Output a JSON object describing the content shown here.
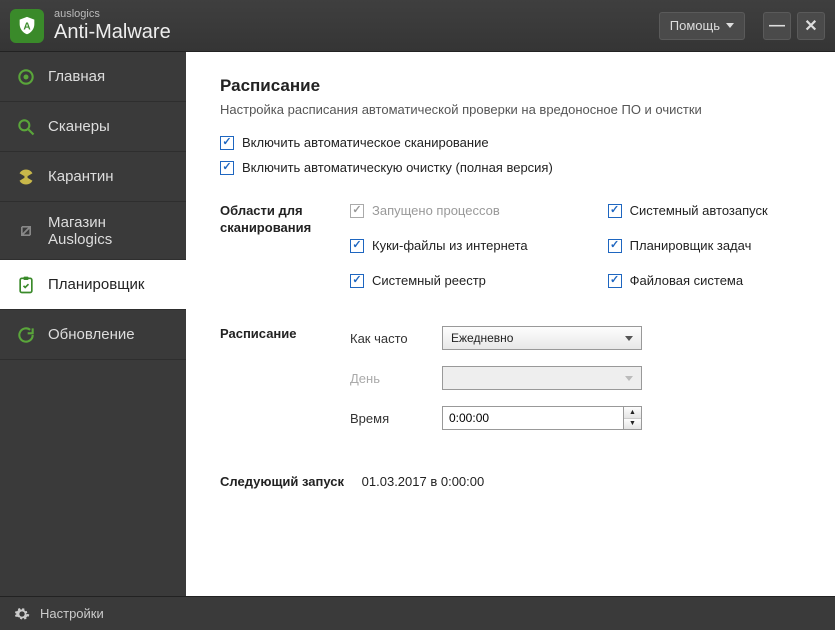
{
  "titlebar": {
    "brand_small": "auslogics",
    "brand_big": "Anti-Malware",
    "help_label": "Помощь"
  },
  "sidebar": {
    "items": [
      {
        "label": "Главная",
        "icon": "target-icon"
      },
      {
        "label": "Сканеры",
        "icon": "search-icon"
      },
      {
        "label": "Карантин",
        "icon": "radioactive-icon"
      },
      {
        "label": "Магазин Auslogics",
        "icon": "globe-icon"
      },
      {
        "label": "Планировщик",
        "icon": "clipboard-icon"
      },
      {
        "label": "Обновление",
        "icon": "refresh-icon"
      }
    ],
    "active_index": 4
  },
  "main": {
    "title": "Расписание",
    "subtitle": "Настройка расписания автоматической проверки на вредоносное ПО и очистки",
    "enable_scan": "Включить автоматическое сканирование",
    "enable_clean": "Включить автоматическую очистку (полная версия)",
    "scan_areas_label": "Области для сканирования",
    "scan_areas": {
      "left": [
        {
          "label": "Запущено процессов",
          "checked": true,
          "disabled": true
        },
        {
          "label": "Куки-файлы из интернета",
          "checked": true,
          "disabled": false
        },
        {
          "label": "Системный реестр",
          "checked": true,
          "disabled": false
        }
      ],
      "right": [
        {
          "label": "Системный автозапуск",
          "checked": true,
          "disabled": false
        },
        {
          "label": "Планировщик задач",
          "checked": true,
          "disabled": false
        },
        {
          "label": "Файловая система",
          "checked": true,
          "disabled": false
        }
      ]
    },
    "schedule_label": "Расписание",
    "how_often_label": "Как часто",
    "how_often_value": "Ежедневно",
    "day_label": "День",
    "day_value": "",
    "time_label": "Время",
    "time_value": "0:00:00",
    "next_run_label": "Следующий запуск",
    "next_run_value": "01.03.2017 в 0:00:00"
  },
  "footer": {
    "settings": "Настройки"
  },
  "colors": {
    "accent": "#3a8a2a",
    "text_muted": "#888"
  }
}
